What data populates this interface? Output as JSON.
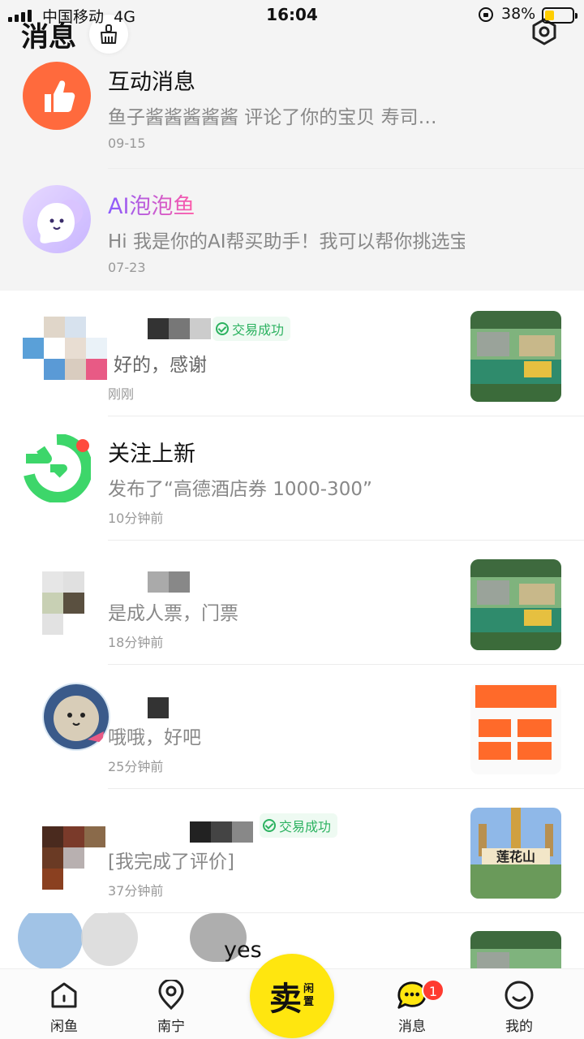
{
  "status_bar": {
    "carrier": "中国移动",
    "network": "4G",
    "time": "16:04",
    "battery": "38%"
  },
  "header": {
    "title": "消息",
    "clean_icon": "broom-icon",
    "settings_icon": "hexagon-settings-icon"
  },
  "conversations": [
    {
      "title": "互动消息",
      "preview": "鱼子酱酱酱酱酱 评论了你的宝贝 寿司…",
      "time": "09-15",
      "avatar_icon": "thumbs-up-icon",
      "avatar_color": "#ff6a3d"
    },
    {
      "title": "AI泡泡鱼",
      "preview": "Hi 我是你的AI帮买助手！我可以帮你挑选宝贝…",
      "time": "07-23",
      "avatar_icon": "ai-fish-mascot-icon"
    },
    {
      "title": "",
      "deal_badge": "交易成功",
      "preview": "好的，感谢",
      "time": "刚刚",
      "thumb": "garden-scenic-photo"
    },
    {
      "title": "关注上新",
      "preview": "发布了“高德酒店券 1000-300”",
      "time": "10分钟前",
      "avatar_icon": "follow-refresh-icon",
      "avatar_color": "#3dd66a"
    },
    {
      "title": "",
      "preview": "是成人票，门票",
      "time": "18分钟前",
      "thumb": "garden-scenic-photo"
    },
    {
      "title": "",
      "preview": "哦哦，好吧",
      "time": "25分钟前",
      "thumb": "orange-coupon-screenshot"
    },
    {
      "title": "",
      "deal_badge": "交易成功",
      "preview": "[我完成了评价]",
      "time": "37分钟前",
      "thumb": "lotus-mountain-photo",
      "thumb_text": "莲花山"
    },
    {
      "title": "yes",
      "thumb": "garden-scenic-photo"
    }
  ],
  "tabbar": {
    "tabs": [
      {
        "label": "闲鱼",
        "icon": "home-icon"
      },
      {
        "label": "南宁",
        "icon": "location-pin-icon"
      },
      {
        "label": "消息",
        "icon": "chat-bubble-icon",
        "badge": "1"
      },
      {
        "label": "我的",
        "icon": "smiley-profile-icon"
      }
    ],
    "sell": {
      "main": "卖",
      "sub": "闲置"
    }
  },
  "colors": {
    "accent_yellow": "#ffe60f",
    "deal_green": "#2cb260",
    "badge_red": "#ff3b30"
  }
}
